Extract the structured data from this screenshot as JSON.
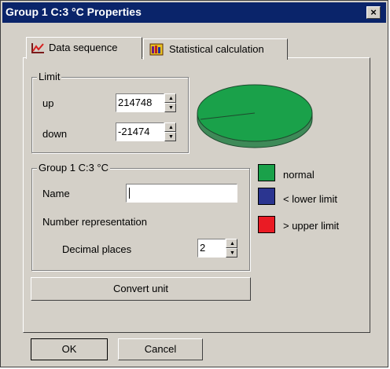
{
  "window": {
    "title": "Group 1 C:3 °C Properties",
    "close_glyph": "×"
  },
  "tabs": [
    {
      "label": "Data sequence",
      "icon": "chart-line-icon",
      "active": true
    },
    {
      "label": "Statistical calculation",
      "icon": "statistics-icon",
      "active": false
    }
  ],
  "limit": {
    "group_title": "Limit",
    "up_label": "up",
    "up_value": "214748",
    "down_label": "down",
    "down_value": "-21474"
  },
  "group": {
    "title": "Group 1 C:3 °C",
    "name_label": "Name",
    "name_value": "",
    "number_representation_label": "Number representation",
    "decimal_places_label": "Decimal places",
    "decimal_places_value": "2"
  },
  "convert_unit_label": "Convert unit",
  "legend": [
    {
      "label": "normal",
      "color": "#1aa14a"
    },
    {
      "label": "< lower limit",
      "color": "#2b3590"
    },
    {
      "label": "> upper limit",
      "color": "#ea1b24"
    }
  ],
  "pie": {
    "normal_fraction": 1.0,
    "top_color": "#1aa14a",
    "side_color": "#3e8a58"
  },
  "buttons": {
    "ok_label": "OK",
    "cancel_label": "Cancel"
  }
}
